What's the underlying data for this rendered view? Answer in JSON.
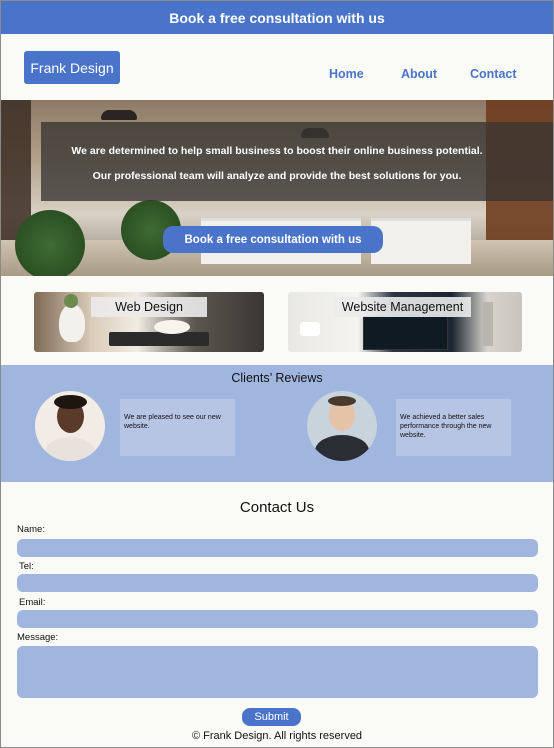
{
  "banner": {
    "text": "Book a free consultation with us"
  },
  "header": {
    "logo": "Frank Design",
    "nav": [
      {
        "label": "Home"
      },
      {
        "label": "About"
      },
      {
        "label": "Contact"
      }
    ]
  },
  "hero": {
    "line1": "We are determined to help small business to  boost their online business potential.",
    "line2": "Our professional team will analyze and provide the best solutions for you.",
    "button": "Book a free consultation with us"
  },
  "services": [
    {
      "label": "Web Design"
    },
    {
      "label": "Website Management"
    }
  ],
  "reviews": {
    "title": "Clients’ Reviews",
    "items": [
      {
        "text": "We are pleased to see our new website."
      },
      {
        "text": "We achieved a better sales performance through the new website."
      }
    ]
  },
  "contact": {
    "title": "Contact Us",
    "fields": [
      {
        "label": "Name:"
      },
      {
        "label": "Tel:"
      },
      {
        "label": "Email:"
      },
      {
        "label": "Message:"
      }
    ],
    "submit": "Submit"
  },
  "footer": {
    "text": "© Frank Design. All rights reserved"
  },
  "colors": {
    "accent": "#4a74c9",
    "light_accent": "#a1b6df",
    "background": "#fafaf6"
  }
}
